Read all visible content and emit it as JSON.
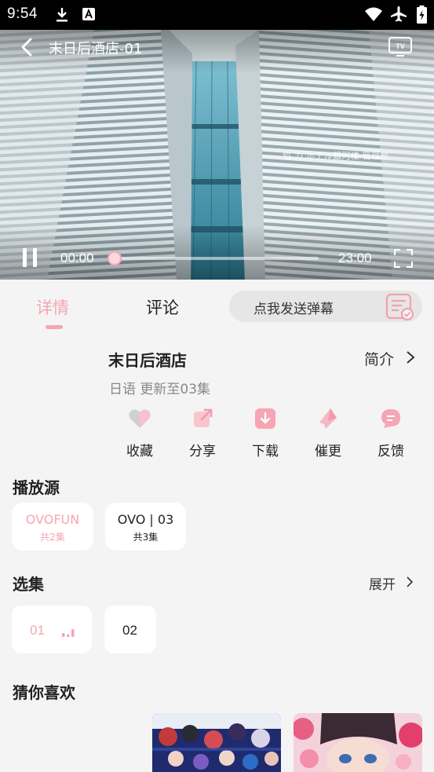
{
  "status_bar": {
    "time": "9:54"
  },
  "player": {
    "title": "末日后酒店-01",
    "credit": "協 力   ホテル銀河楼 管理部",
    "current_time": "00:00",
    "duration": "23:00",
    "progress": 0.0
  },
  "tabs": [
    {
      "label": "详情",
      "active": true
    },
    {
      "label": "评论",
      "active": false
    }
  ],
  "danmaku": {
    "placeholder": "点我发送弹幕"
  },
  "show": {
    "title": "末日后酒店",
    "intro_label": "简介",
    "meta": "日语 更新至03集"
  },
  "actions": [
    {
      "label": "收藏",
      "icon": "heart-icon"
    },
    {
      "label": "分享",
      "icon": "share-icon"
    },
    {
      "label": "下载",
      "icon": "download-icon"
    },
    {
      "label": "催更",
      "icon": "boost-icon"
    },
    {
      "label": "反馈",
      "icon": "feedback-icon"
    }
  ],
  "sources": {
    "title": "播放源",
    "items": [
      {
        "name": "OVOFUN",
        "count": "共2集",
        "selected": true
      },
      {
        "name": "OVO | 03",
        "count": "共3集",
        "selected": false
      }
    ]
  },
  "episodes": {
    "title": "选集",
    "expand_label": "展开",
    "items": [
      {
        "label": "01",
        "playing": true
      },
      {
        "label": "02",
        "playing": false
      }
    ]
  },
  "recommend": {
    "title": "猜你喜欢"
  },
  "colors": {
    "accent": "#f6a5b4",
    "background": "#f4f4f4",
    "card": "#ffffff"
  }
}
